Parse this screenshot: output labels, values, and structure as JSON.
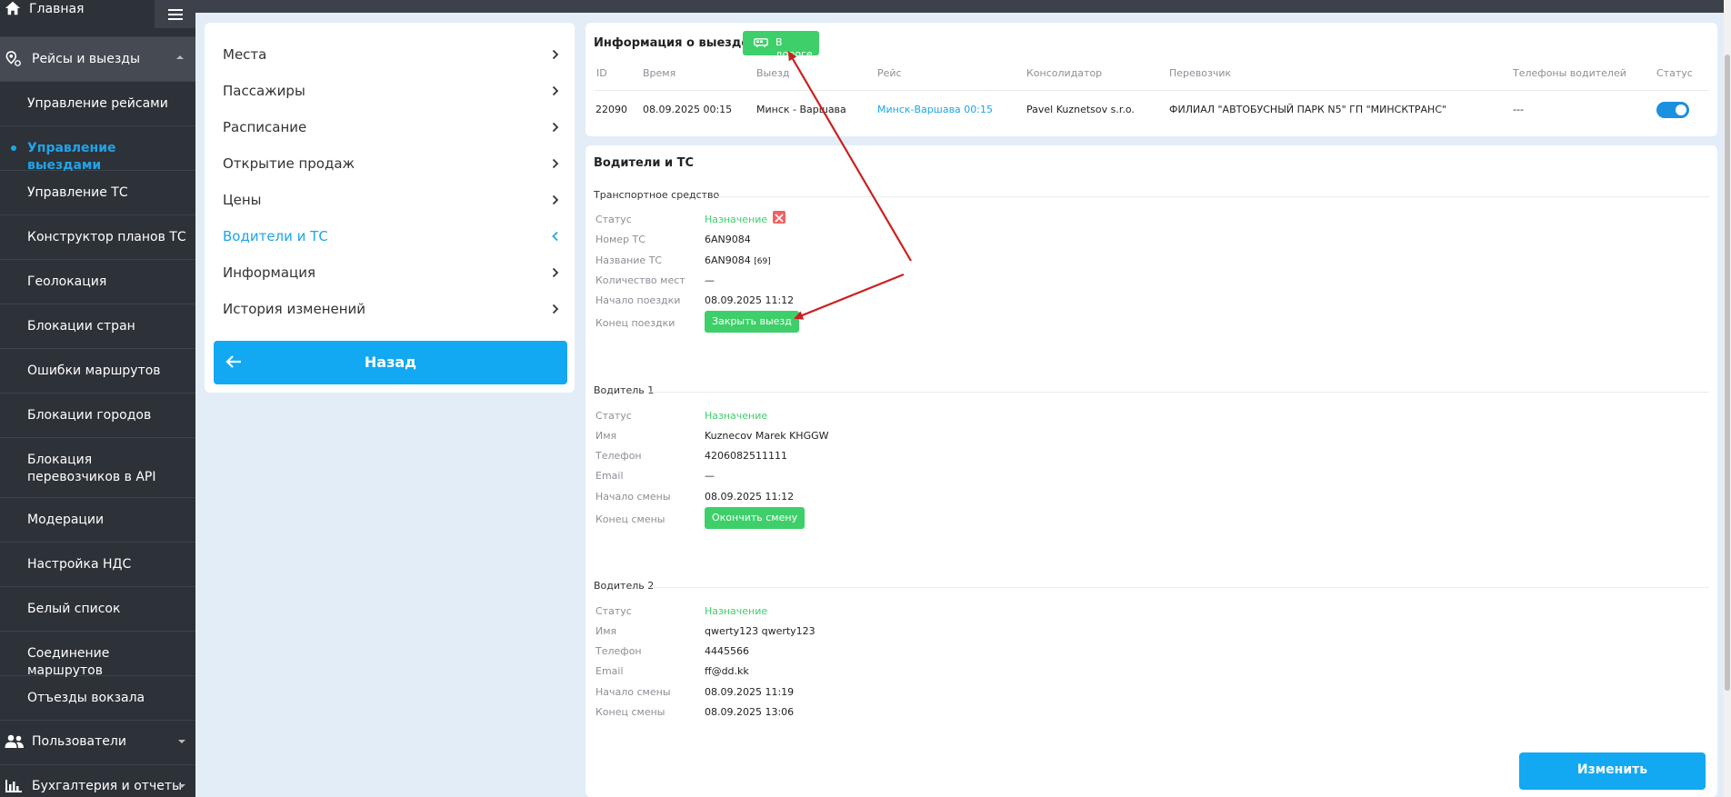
{
  "sidebar": {
    "home_label": "Главная",
    "group_trips": "Рейсы и выезды",
    "items": [
      {
        "label": "Управление рейсами"
      },
      {
        "label": "Управление выездами"
      },
      {
        "label": "Управление ТС"
      },
      {
        "label": "Конструктор планов ТС"
      },
      {
        "label": "Геолокация"
      },
      {
        "label": "Блокации стран"
      },
      {
        "label": "Ошибки маршрутов"
      },
      {
        "label": "Блокации городов"
      },
      {
        "label": "Блокация перевозчиков в API"
      },
      {
        "label": "Модерации"
      },
      {
        "label": "Настройка НДС"
      },
      {
        "label": "Белый список"
      },
      {
        "label": "Соединение маршрутов"
      },
      {
        "label": "Отъезды вокзала"
      }
    ],
    "group_users": "Пользователи",
    "group_accounting": "Бухгалтерия и отчеты"
  },
  "left_menu": {
    "items": [
      {
        "label": "Места"
      },
      {
        "label": "Пассажиры"
      },
      {
        "label": "Расписание"
      },
      {
        "label": "Открытие продаж"
      },
      {
        "label": "Цены"
      },
      {
        "label": "Водители и ТС"
      },
      {
        "label": "Информация"
      },
      {
        "label": "История изменений"
      }
    ],
    "back_label": "Назад"
  },
  "trip_info": {
    "title": "Информация о выезде",
    "status_pill": "В дороге",
    "columns": [
      "ID",
      "Время",
      "Выезд",
      "Рейс",
      "Консолидатор",
      "Перевозчик",
      "Телефоны водителей",
      "Статус"
    ],
    "row": {
      "id": "22090",
      "time": "08.09.2025 00:15",
      "departure": "Минск - Варшава",
      "route": "Минск-Варшава 00:15",
      "consolidator": "Pavel Kuznetsov s.r.o.",
      "carrier": "ФИЛИАЛ \"АВТОБУСНЫЙ ПАРК N5\" ГП \"МИНСКТРАНС\"",
      "driver_phones": "---",
      "status_on": true
    }
  },
  "drivers": {
    "title": "Водители и ТС",
    "vehicle": {
      "section": "Транспортное средство",
      "status_label": "Статус",
      "status_value": "Назначение",
      "plate_label": "Номер ТС",
      "plate_value": "6AN9084",
      "name_label": "Название ТС",
      "name_value": "6AN9084",
      "name_seats": "[69]",
      "seats_label": "Количество мест",
      "seats_value": "—",
      "start_label": "Начало поездки",
      "start_value": "08.09.2025 11:12",
      "end_label": "Конец поездки",
      "end_button": "Закрыть выезд"
    },
    "driver1": {
      "section": "Водитель 1",
      "status_label": "Статус",
      "status_value": "Назначение",
      "name_label": "Имя",
      "name_value": "Kuznecov Marek KHGGW",
      "phone_label": "Телефон",
      "phone_value": "4206082511111",
      "email_label": "Email",
      "email_value": "—",
      "start_label": "Начало смены",
      "start_value": "08.09.2025 11:12",
      "end_label": "Конец смены",
      "end_button": "Окончить смену"
    },
    "driver2": {
      "section": "Водитель 2",
      "status_label": "Статус",
      "status_value": "Назначение",
      "name_label": "Имя",
      "name_value": "qwerty123 qwerty123",
      "phone_label": "Телефон",
      "phone_value": "4445566",
      "email_label": "Email",
      "email_value": "ff@dd.kk",
      "start_label": "Начало смены",
      "start_value": "08.09.2025 11:19",
      "end_label": "Конец смены",
      "end_value": "08.09.2025 13:06"
    },
    "edit_button": "Изменить"
  },
  "colors": {
    "accent": "#1fa4e8",
    "button_blue": "#12a9f2",
    "green": "#3ecf6a",
    "sidebar_bg": "#2d3138",
    "annotation_arrow": "#cc1f1f"
  }
}
